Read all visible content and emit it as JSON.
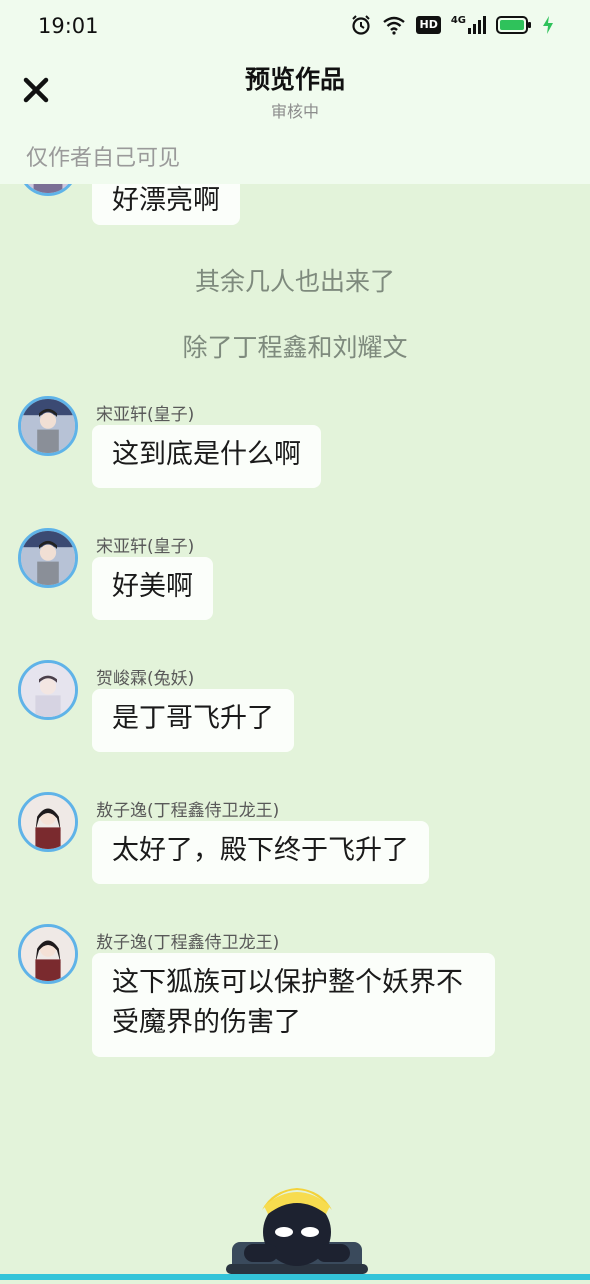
{
  "status": {
    "time": "19:01",
    "network": "4G",
    "hd": "HD"
  },
  "header": {
    "title": "预览作品",
    "subtitle": "审核中",
    "visibility": "仅作者自己可见"
  },
  "messages": [
    {
      "type": "bubble",
      "text": "好漂亮啊"
    },
    {
      "type": "narration",
      "text": "其余几人也出来了"
    },
    {
      "type": "narration",
      "text": "除了丁程鑫和刘耀文"
    },
    {
      "type": "bubble",
      "sender": "宋亚轩(皇子)",
      "text": "这到底是什么啊"
    },
    {
      "type": "bubble",
      "sender": "宋亚轩(皇子)",
      "text": "好美啊"
    },
    {
      "type": "bubble",
      "sender": "贺峻霖(兔妖)",
      "text": "是丁哥飞升了"
    },
    {
      "type": "bubble",
      "sender": "敖子逸(丁程鑫侍卫龙王)",
      "text": "太好了，殿下终于飞升了"
    },
    {
      "type": "bubble",
      "sender": "敖子逸(丁程鑫侍卫龙王)",
      "text_line1": "这下狐族可以保护整个妖界不",
      "text_line2": "受魔界的伤害了"
    }
  ],
  "colors": {
    "background": "#e3f3da",
    "header": "#f0fbee",
    "bubble": "#fbfefa",
    "avatar_border": "#5fb3e8",
    "bottom_bar": "#33c4d9"
  },
  "icons": {
    "close": "close-icon",
    "alarm": "alarm-icon",
    "wifi": "wifi-icon",
    "signal": "signal-icon",
    "battery": "battery-icon",
    "charging": "charging-icon",
    "mascot": "mascot-icon"
  }
}
